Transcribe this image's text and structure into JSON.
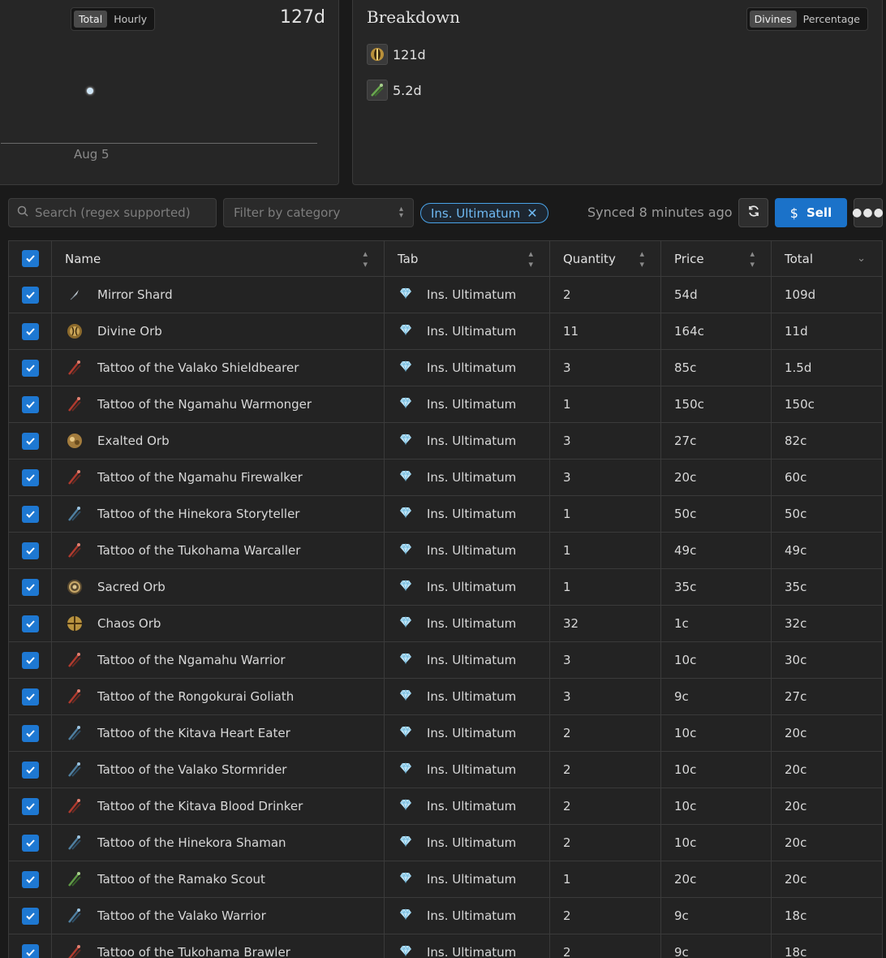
{
  "chart": {
    "toggle": [
      "Total",
      "Hourly"
    ],
    "total": "127d",
    "x_tick": "Aug 5"
  },
  "chart_data": {
    "type": "scatter",
    "x": [
      "Aug 5"
    ],
    "values": [
      127
    ]
  },
  "breakdown": {
    "title": "Breakdown",
    "toggle": [
      "Divines",
      "Percentage"
    ],
    "items": [
      {
        "icon": "divine-orb-icon",
        "value": "121d"
      },
      {
        "icon": "tattoo-icon",
        "value": "5.2d"
      }
    ]
  },
  "toolbar": {
    "search_placeholder": "Search (regex supported)",
    "category_placeholder": "Filter by category",
    "chip_label": "Ins. Ultimatum",
    "synced": "Synced 8 minutes ago",
    "sell_label": "Sell"
  },
  "table": {
    "columns": [
      "Name",
      "Tab",
      "Quantity",
      "Price",
      "Total"
    ],
    "rows": [
      {
        "name": "Mirror Shard",
        "icon": "mirror-shard",
        "tab": "Ins. Ultimatum",
        "qty": "2",
        "price": "54d",
        "total": "109d"
      },
      {
        "name": "Divine Orb",
        "icon": "divine-orb",
        "tab": "Ins. Ultimatum",
        "qty": "11",
        "price": "164c",
        "total": "11d"
      },
      {
        "name": "Tattoo of the Valako Shieldbearer",
        "icon": "tattoo-red",
        "tab": "Ins. Ultimatum",
        "qty": "3",
        "price": "85c",
        "total": "1.5d"
      },
      {
        "name": "Tattoo of the Ngamahu Warmonger",
        "icon": "tattoo-red",
        "tab": "Ins. Ultimatum",
        "qty": "1",
        "price": "150c",
        "total": "150c"
      },
      {
        "name": "Exalted Orb",
        "icon": "exalted-orb",
        "tab": "Ins. Ultimatum",
        "qty": "3",
        "price": "27c",
        "total": "82c"
      },
      {
        "name": "Tattoo of the Ngamahu Firewalker",
        "icon": "tattoo-red",
        "tab": "Ins. Ultimatum",
        "qty": "3",
        "price": "20c",
        "total": "60c"
      },
      {
        "name": "Tattoo of the Hinekora Storyteller",
        "icon": "tattoo-blue",
        "tab": "Ins. Ultimatum",
        "qty": "1",
        "price": "50c",
        "total": "50c"
      },
      {
        "name": "Tattoo of the Tukohama Warcaller",
        "icon": "tattoo-red",
        "tab": "Ins. Ultimatum",
        "qty": "1",
        "price": "49c",
        "total": "49c"
      },
      {
        "name": "Sacred Orb",
        "icon": "sacred-orb",
        "tab": "Ins. Ultimatum",
        "qty": "1",
        "price": "35c",
        "total": "35c"
      },
      {
        "name": "Chaos Orb",
        "icon": "chaos-orb",
        "tab": "Ins. Ultimatum",
        "qty": "32",
        "price": "1c",
        "total": "32c"
      },
      {
        "name": "Tattoo of the Ngamahu Warrior",
        "icon": "tattoo-red",
        "tab": "Ins. Ultimatum",
        "qty": "3",
        "price": "10c",
        "total": "30c"
      },
      {
        "name": "Tattoo of the Rongokurai Goliath",
        "icon": "tattoo-red",
        "tab": "Ins. Ultimatum",
        "qty": "3",
        "price": "9c",
        "total": "27c"
      },
      {
        "name": "Tattoo of the Kitava Heart Eater",
        "icon": "tattoo-blue",
        "tab": "Ins. Ultimatum",
        "qty": "2",
        "price": "10c",
        "total": "20c"
      },
      {
        "name": "Tattoo of the Valako Stormrider",
        "icon": "tattoo-blue",
        "tab": "Ins. Ultimatum",
        "qty": "2",
        "price": "10c",
        "total": "20c"
      },
      {
        "name": "Tattoo of the Kitava Blood Drinker",
        "icon": "tattoo-red",
        "tab": "Ins. Ultimatum",
        "qty": "2",
        "price": "10c",
        "total": "20c"
      },
      {
        "name": "Tattoo of the Hinekora Shaman",
        "icon": "tattoo-blue",
        "tab": "Ins. Ultimatum",
        "qty": "2",
        "price": "10c",
        "total": "20c"
      },
      {
        "name": "Tattoo of the Ramako Scout",
        "icon": "tattoo-green",
        "tab": "Ins. Ultimatum",
        "qty": "1",
        "price": "20c",
        "total": "20c"
      },
      {
        "name": "Tattoo of the Valako Warrior",
        "icon": "tattoo-blue",
        "tab": "Ins. Ultimatum",
        "qty": "2",
        "price": "9c",
        "total": "18c"
      },
      {
        "name": "Tattoo of the Tukohama Brawler",
        "icon": "tattoo-red",
        "tab": "Ins. Ultimatum",
        "qty": "2",
        "price": "9c",
        "total": "18c"
      }
    ]
  },
  "colors": {
    "accent": "#1e78d2",
    "chip": "#4aa3e8",
    "tattoo-red": "#c0392b",
    "tattoo-blue": "#5d8fb0",
    "tattoo-green": "#6aa84f"
  }
}
